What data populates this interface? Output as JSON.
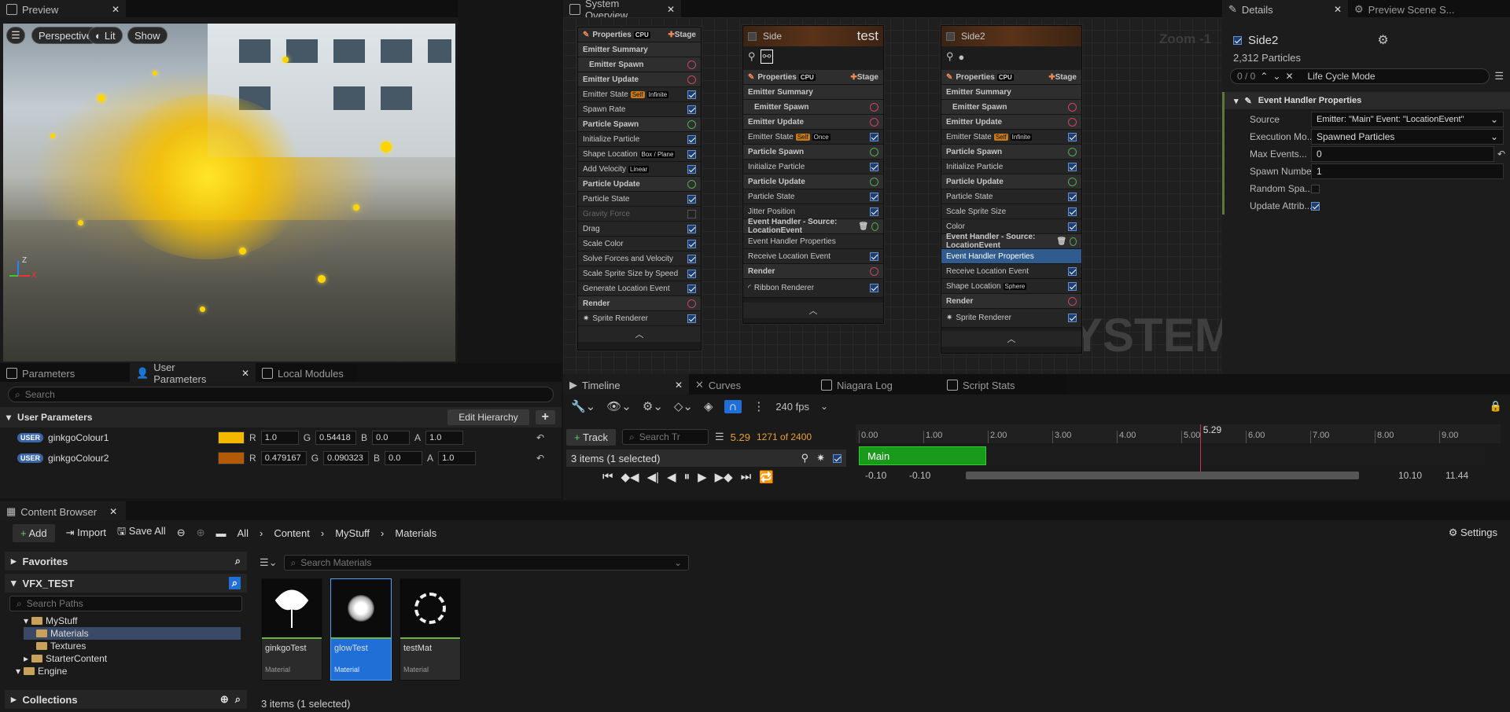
{
  "preview": {
    "tab": "Preview",
    "perspective": "Perspective",
    "lit": "Lit",
    "show": "Show",
    "axis_z": "Z",
    "axis_x": "X"
  },
  "overview": {
    "tab": "System Overview",
    "zoom": "Zoom -1",
    "watermark": "SYSTEM",
    "main_node": {
      "properties": "Properties",
      "cpu": "CPU",
      "stage": "Stage",
      "rows": [
        "Emitter Summary",
        "Emitter Spawn",
        "Emitter Update",
        "Emitter State",
        "Spawn Rate",
        "Particle Spawn",
        "Initialize Particle",
        "Shape Location",
        "Add Velocity",
        "Particle Update",
        "Particle State",
        "Gravity Force",
        "Drag",
        "Scale Color",
        "Solve Forces and Velocity",
        "Scale Sprite Size by Speed",
        "Generate Location Event",
        "Render",
        "Sprite Renderer"
      ],
      "tag_self": "Self",
      "tag_infinite": "Infinite",
      "tag_box": "Box / Plane",
      "tag_linear": "Linear"
    },
    "side_node": {
      "title": "Side",
      "label": "test",
      "properties": "Properties",
      "cpu": "CPU",
      "stage": "Stage",
      "rows": [
        "Emitter Summary",
        "Emitter Spawn",
        "Emitter Update",
        "Emitter State",
        "Particle Spawn",
        "Initialize Particle",
        "Particle Update",
        "Particle State",
        "Jitter Position",
        "Event Handler - Source: LocationEvent",
        "Event Handler Properties",
        "Receive Location Event",
        "Render",
        "Ribbon Renderer"
      ],
      "tag_self": "Self",
      "tag_once": "Once"
    },
    "side2_node": {
      "title": "Side2",
      "properties": "Properties",
      "cpu": "CPU",
      "stage": "Stage",
      "rows": [
        "Emitter Summary",
        "Emitter Spawn",
        "Emitter Update",
        "Emitter State",
        "Particle Spawn",
        "Initialize Particle",
        "Particle Update",
        "Particle State",
        "Scale Sprite Size",
        "Color",
        "Event Handler - Source: LocationEvent",
        "Event Handler Properties",
        "Receive Location Event",
        "Shape Location",
        "Render",
        "Sprite Renderer"
      ],
      "tag_self": "Self",
      "tag_infinite": "Infinite",
      "tag_sphere": "Sphere"
    }
  },
  "details": {
    "tab": "Details",
    "tab2": "Preview Scene S...",
    "name": "Side2",
    "particles": "2,312 Particles",
    "counter": "0 / 0",
    "search": "Life Cycle Mode",
    "section": "Event Handler Properties",
    "fields": [
      {
        "label": "Source",
        "value": "Emitter: \"Main\" Event: \"LocationEvent\""
      },
      {
        "label": "Execution Mo...",
        "value": "Spawned Particles"
      },
      {
        "label": "Max Events...",
        "value": "0"
      },
      {
        "label": "Spawn Number",
        "value": "1"
      },
      {
        "label": "Random Spa...",
        "value": ""
      },
      {
        "label": "Update Attrib...",
        "value": ""
      }
    ]
  },
  "params": {
    "tab1": "Parameters",
    "tab2": "User Parameters",
    "tab3": "Local Modules",
    "search": "Search",
    "section": "User Parameters",
    "edit": "Edit Hierarchy",
    "items": [
      {
        "name": "ginkgoColour1",
        "tag": "USER",
        "color": "#f5b800",
        "r": "1.0",
        "g": "0.54418",
        "b": "0.0",
        "a": "1.0"
      },
      {
        "name": "ginkgoColour2",
        "tag": "USER",
        "color": "#b25a06",
        "r": "0.479167",
        "g": "0.090323",
        "b": "0.0",
        "a": "1.0"
      }
    ],
    "lr": "R",
    "lg": "G",
    "lb": "B",
    "la": "A"
  },
  "timeline": {
    "tab1": "Timeline",
    "tab2": "Curves",
    "tab3": "Niagara Log",
    "tab4": "Script Stats",
    "fps": "240 fps",
    "track": "Track",
    "search": "Search Tr",
    "time": "5.29",
    "frames": "1271 of 2400",
    "items": "3 items (1 selected)",
    "track_name": "Main",
    "playhead": "5.29",
    "ticks": [
      "0.00",
      "1.00",
      "2.00",
      "3.00",
      "4.00",
      "5.00",
      "6.00",
      "7.00",
      "8.00",
      "9.00"
    ],
    "range": [
      "-0.10",
      "-0.10",
      "10.10",
      "11.44"
    ]
  },
  "content": {
    "tab": "Content Browser",
    "add": "Add",
    "import": "Import",
    "saveall": "Save All",
    "crumbs": [
      "All",
      "Content",
      "MyStuff",
      "Materials"
    ],
    "settings": "Settings",
    "favorites": "Favorites",
    "project": "VFX_TEST",
    "search_paths": "Search Paths",
    "search_mat": "Search Materials",
    "tree": [
      "MyStuff",
      "Materials",
      "Textures",
      "StarterContent",
      "Engine"
    ],
    "collections": "Collections",
    "count": "3 items (1 selected)",
    "assets": [
      {
        "name": "ginkgoTest",
        "type": "Material"
      },
      {
        "name": "glowTest",
        "type": "Material"
      },
      {
        "name": "testMat",
        "type": "Material"
      }
    ]
  }
}
